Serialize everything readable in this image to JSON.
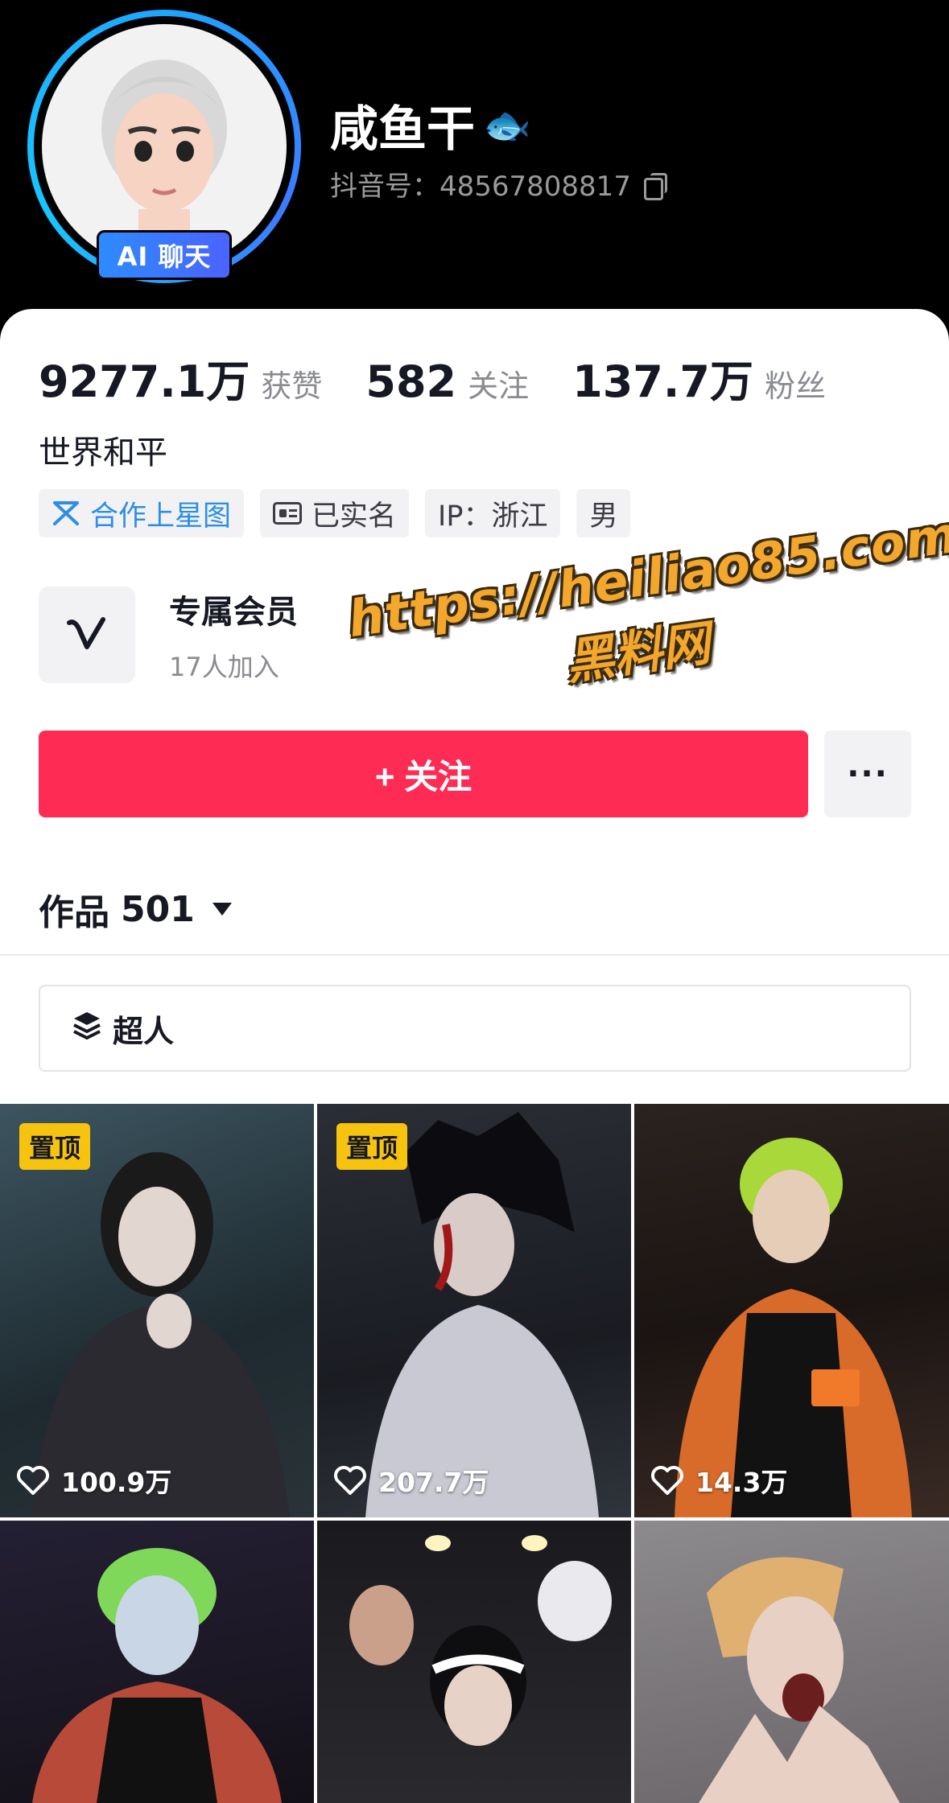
{
  "profile": {
    "nickname": "咸鱼干",
    "nickname_emoji": "🐟",
    "douyin_id": "抖音号：48567808817",
    "ai_badge": "AI 聊天",
    "bio": "世界和平"
  },
  "stats": [
    {
      "value": "9277.1万",
      "label": "获赞"
    },
    {
      "value": "582",
      "label": "关注"
    },
    {
      "value": "137.7万",
      "label": "粉丝"
    }
  ],
  "tags": {
    "xingtu": "合作上星图",
    "verified": "已实名",
    "ip": "IP：浙江",
    "gender": "男"
  },
  "membership": {
    "title": "专属会员",
    "joined": "17人加入"
  },
  "watermark": {
    "url": "https://heiliao85.com",
    "name": "黑料网"
  },
  "actions": {
    "follow": "+ 关注",
    "more": "···"
  },
  "works": {
    "label": "作品",
    "count": "501"
  },
  "collection": {
    "label": "超人"
  },
  "videos": [
    {
      "pinned": "置顶",
      "likes": "100.9万"
    },
    {
      "pinned": "置顶",
      "likes": "207.7万"
    },
    {
      "pinned": "",
      "likes": "14.3万"
    },
    {
      "pinned": "",
      "likes": ""
    },
    {
      "pinned": "",
      "likes": ""
    },
    {
      "pinned": "",
      "likes": ""
    }
  ],
  "colors": {
    "follow_button": "#fe2c55",
    "pin_badge": "#f6c40f",
    "ai_badge": "#2e8bff",
    "watermark": "#f3a72c"
  },
  "icons": [
    "copy-icon",
    "xingtu-icon",
    "id-card-icon",
    "collection-stack-icon",
    "heart-icon",
    "caret-down-icon",
    "vip-v-icon"
  ]
}
